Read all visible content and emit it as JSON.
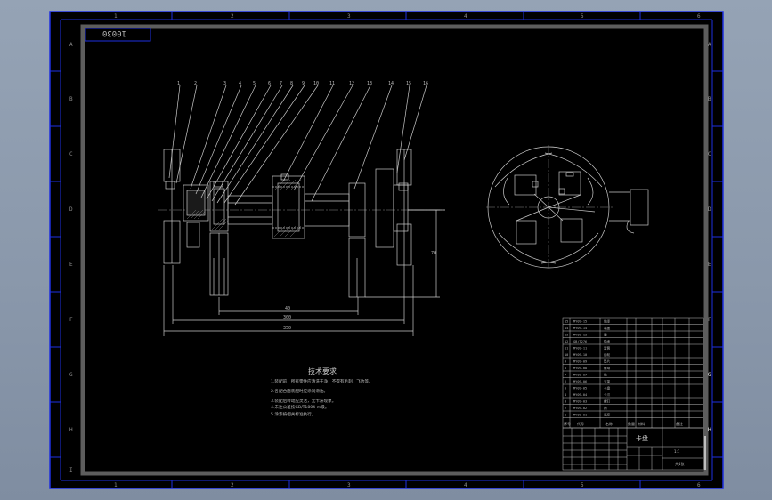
{
  "drawing": {
    "code": "10030",
    "zone_numbers": [
      "1",
      "2",
      "3",
      "4",
      "5",
      "6"
    ],
    "zone_letters": [
      "A",
      "B",
      "C",
      "D",
      "E",
      "F",
      "G",
      "H",
      "I"
    ],
    "balloons": [
      "1",
      "2",
      "3",
      "4",
      "5",
      "6",
      "7",
      "8",
      "9",
      "10",
      "11",
      "12",
      "13",
      "14",
      "15",
      "16"
    ],
    "notes_title": "技术要求",
    "notes_lines": [
      "1.装配前，所有零件应清洗干净，不得有毛刺、飞边等。",
      "2.各配合面装配时应涂润滑油。",
      "3.装配后转动应灵活，无卡滞现象。",
      "4.未注公差按GB/T1804-m级。",
      "5.涂漆按相关标准执行。"
    ],
    "dims": {
      "d1": "40",
      "d2": "300",
      "d3": "350",
      "d4": "70"
    }
  },
  "bom": {
    "rows": [
      {
        "no": "15",
        "code": "MY09-15",
        "name": "轴承"
      },
      {
        "no": "14",
        "code": "MY09-14",
        "name": "端盖"
      },
      {
        "no": "13",
        "code": "MY09-13",
        "name": "键"
      },
      {
        "no": "12",
        "code": "GB/T276",
        "name": "轴承"
      },
      {
        "no": "11",
        "code": "MY09-11",
        "name": "套筒"
      },
      {
        "no": "10",
        "code": "MY09-10",
        "name": "齿轮"
      },
      {
        "no": "9",
        "code": "MY09-09",
        "name": "垫片"
      },
      {
        "no": "8",
        "code": "MY09-08",
        "name": "螺母"
      },
      {
        "no": "7",
        "code": "MY09-07",
        "name": "轴"
      },
      {
        "no": "6",
        "code": "MY09-06",
        "name": "支架"
      },
      {
        "no": "5",
        "code": "MY09-05",
        "name": "卡盘"
      },
      {
        "no": "4",
        "code": "MY09-04",
        "name": "卡爪"
      },
      {
        "no": "3",
        "code": "MY09-03",
        "name": "螺钉"
      },
      {
        "no": "2",
        "code": "MY09-02",
        "name": "销"
      },
      {
        "no": "1",
        "code": "MY09-01",
        "name": "底座"
      }
    ],
    "header_cells": [
      "序号",
      "代号",
      "名称",
      "数量",
      "材料",
      "备注"
    ]
  },
  "title_block": {
    "name": "卡盘",
    "scale": "1:1",
    "sheet": "共1张"
  }
}
